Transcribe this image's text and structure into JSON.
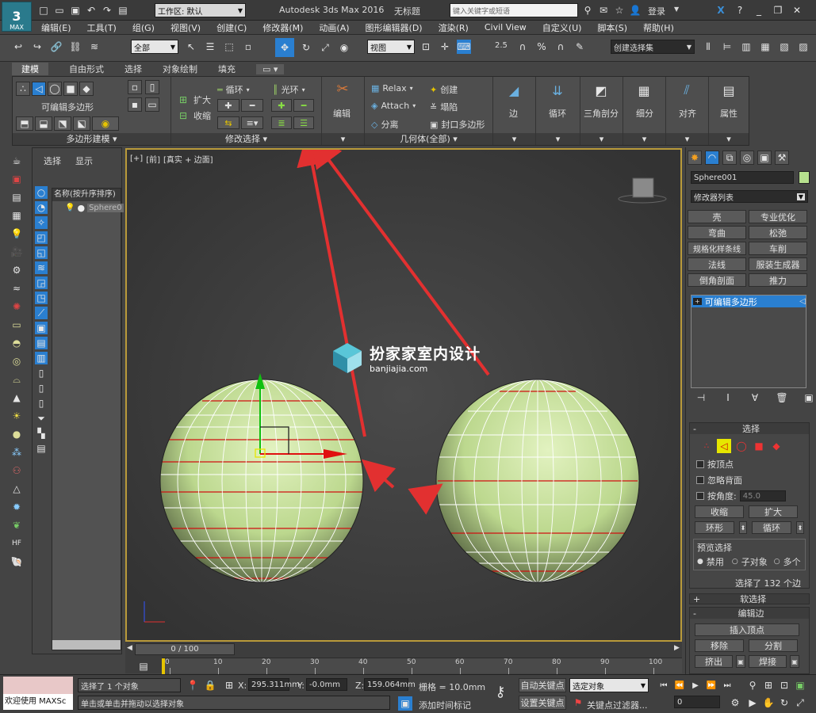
{
  "titlebar": {
    "workspace_label": "工作区: 默认",
    "app_title": "Autodesk 3ds Max 2016",
    "doc_title": "无标题",
    "search_placeholder": "键入关键字或短语",
    "login": "登录",
    "logo_text": "MAX"
  },
  "menu": [
    "编辑(E)",
    "工具(T)",
    "组(G)",
    "视图(V)",
    "创建(C)",
    "修改器(M)",
    "动画(A)",
    "图形编辑器(D)",
    "渲染(R)",
    "Civil View",
    "自定义(U)",
    "脚本(S)",
    "帮助(H)"
  ],
  "toolbar": {
    "filter_select": "全部",
    "view_select": "视图",
    "snap_25": "2.5",
    "selection_set": "创建选择集"
  },
  "ribbon": {
    "tabs": [
      "建模",
      "自由形式",
      "选择",
      "对象绘制",
      "填充"
    ],
    "panel_poly_title": "多边形建模",
    "editable_poly": "可编辑多边形",
    "panel_modsel_title": "修改选择",
    "grow": "扩大",
    "shrink": "收缩",
    "loop": "循环",
    "ring": "光环",
    "edit": "编辑",
    "relax": "Relax",
    "attach": "Attach",
    "detach": "分离",
    "create": "创建",
    "collapse": "塌陷",
    "cap_poly": "封口多边形",
    "panel_geom_title": "几何体(全部)",
    "edge": "边",
    "loops": "循环",
    "tri": "三角剖分",
    "subdiv": "细分",
    "align": "对齐",
    "props": "属性"
  },
  "scene_explorer": {
    "tab_select": "选择",
    "tab_display": "显示",
    "column_header": "名称(按升序排序)",
    "item": "Sphere0"
  },
  "viewport": {
    "label_plus": "[+]",
    "label_view": "[前]",
    "label_shading": "[真实 + 边面]",
    "watermark_cn": "扮家家室内设计",
    "watermark_en": "banjiajia.com"
  },
  "cmdpanel": {
    "object_name": "Sphere001",
    "modifier_list": "修改器列表",
    "modifier_buttons": [
      "壳",
      "专业优化",
      "弯曲",
      "松弛",
      "规格化样条线",
      "车削",
      "法线",
      "服装生成器",
      "倒角剖面",
      "推力"
    ],
    "stack_item": "可编辑多边形",
    "rollout_select": "选择",
    "by_vertex": "按顶点",
    "ignore_backface": "忽略背面",
    "by_angle": "按角度:",
    "angle_value": "45.0",
    "shrink": "收缩",
    "grow": "扩大",
    "ring": "环形",
    "loop": "循环",
    "preview_select": "预览选择",
    "preview_off": "禁用",
    "preview_sub": "子对象",
    "preview_multi": "多个",
    "selection_info": "选择了 132 个边",
    "soft_select": "软选择",
    "edit_edges": "编辑边",
    "insert_vertex": "插入顶点",
    "remove": "移除",
    "split": "分割",
    "extrude": "挤出",
    "weld": "焊接"
  },
  "timeline": {
    "frame_label": "0 / 100",
    "ticks": [
      "0",
      "10",
      "20",
      "30",
      "40",
      "50",
      "60",
      "70",
      "80",
      "90",
      "100"
    ]
  },
  "status": {
    "welcome": "欢迎使用 MAXSc",
    "selected_objects": "选择了 1 个对象",
    "hint": "单击或单击并拖动以选择对象",
    "x_label": "X:",
    "x_value": "295.311mm",
    "y_label": "Y:",
    "y_value": "-0.0mm",
    "z_label": "Z:",
    "z_value": "159.064mm",
    "grid": "栅格 = 10.0mm",
    "add_time_tag": "添加时间标记",
    "auto_key": "自动关键点",
    "selected_object": "选定对象",
    "set_key": "设置关键点",
    "key_filter": "关键点过滤器...",
    "frame_value": "0"
  }
}
